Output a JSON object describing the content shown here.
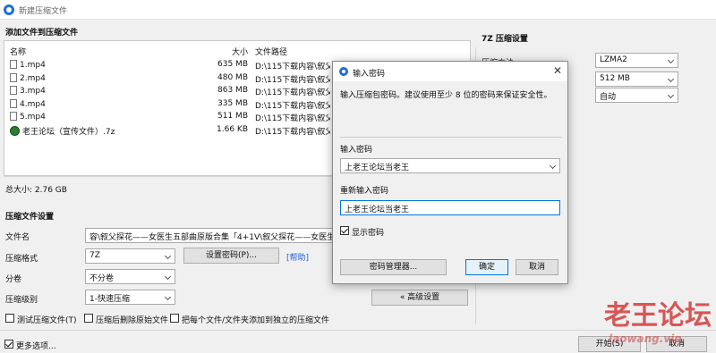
{
  "window": {
    "title": "新建压缩文件"
  },
  "add_section": {
    "title": "添加文件到压缩文件",
    "columns": [
      "名称",
      "大小",
      "文件路径"
    ],
    "rows": [
      {
        "name": "1.mp4",
        "size": "635 MB",
        "path": "D:\\115下载内容\\叙父探花——",
        "icon": "file-icon"
      },
      {
        "name": "2.mp4",
        "size": "480 MB",
        "path": "D:\\115下载内容\\叙父探花——",
        "icon": "file-icon"
      },
      {
        "name": "3.mp4",
        "size": "863 MB",
        "path": "D:\\115下载内容\\叙父探花——",
        "icon": "file-icon"
      },
      {
        "name": "4.mp4",
        "size": "335 MB",
        "path": "D:\\115下载内容\\叙父探花——",
        "icon": "file-icon"
      },
      {
        "name": "5.mp4",
        "size": "511 MB",
        "path": "D:\\115下载内容\\叙父探花——",
        "icon": "file-icon"
      },
      {
        "name": "老王论坛（宣传文件）.7z",
        "size": "1.66 KB",
        "path": "D:\\115下载内容\\叙父探花——",
        "icon": "globe-icon"
      }
    ],
    "total": "总大小: 2.76 GB"
  },
  "settings": {
    "title": "压缩文件设置",
    "filename_label": "文件名",
    "filename_value": "容\\叙父探花——女医生五部曲原版合集「4+1V\\叙父探花——女医生五部曲",
    "format_label": "压缩格式",
    "format_value": "7Z",
    "set_password_label": "设置密码(P)...",
    "help_label": "[帮助]",
    "split_label": "分卷",
    "split_value": "不分卷",
    "level_label": "压缩级别",
    "level_value": "1-快速压缩",
    "advanced_label": "« 高级设置",
    "check_test": "测试压缩文件(T)",
    "check_delete": "压缩后删除原始文件",
    "check_separate": "把每个文件/文件夹添加到独立的压缩文件"
  },
  "sevenz": {
    "title": "7Z 压缩设置",
    "method_label": "压缩方法",
    "method_value": "LZMA2",
    "dict_value": "512 MB",
    "threads_value": "自动"
  },
  "footer": {
    "more_options": "更多选项...",
    "start_label": "开始(S)",
    "cancel_label": "取消"
  },
  "dialog": {
    "title": "输入密码",
    "description": "输入压缩包密码。建议使用至少 8 位的密码来保证安全性。",
    "password_label": "输入密码",
    "password_value": "上老王论坛当老王",
    "confirm_label": "重新输入密码",
    "confirm_value": "上老王论坛当老王",
    "show_password": "显示密码",
    "manager_button": "密码管理器...",
    "ok_button": "确定",
    "cancel_button": "取消"
  },
  "watermark": {
    "text": "老王论坛",
    "subtext": "laowang.vip"
  }
}
